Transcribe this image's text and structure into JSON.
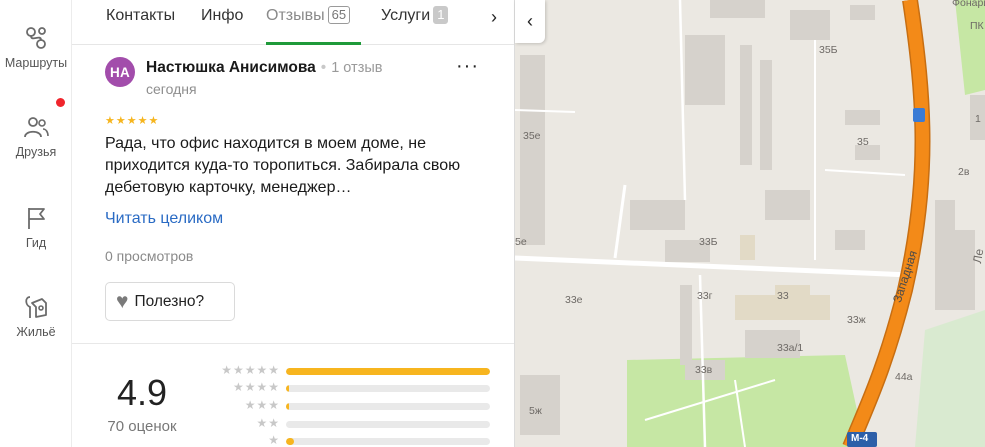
{
  "nav": {
    "items": [
      {
        "label": "Маршруты",
        "icon": "routes-icon"
      },
      {
        "label": "Друзья",
        "icon": "friends-icon"
      },
      {
        "label": "Гид",
        "icon": "flag-icon"
      },
      {
        "label": "Жильё",
        "icon": "housing-icon"
      }
    ]
  },
  "tabs": {
    "items": [
      {
        "label": "Контакты"
      },
      {
        "label": "Инфо"
      },
      {
        "label": "Отзывы",
        "count": "65"
      },
      {
        "label": "Услуги",
        "count": "1"
      }
    ],
    "active": "Отзывы",
    "next_icon": "›"
  },
  "review": {
    "avatar_initials": "НА",
    "author": "Настюшка Анисимова",
    "author_meta": "1 отзыв",
    "date": "сегодня",
    "more_icon": "···",
    "stars": "★★★★★",
    "rating": 5,
    "text": "Рада, что офис находится в моем доме, не приходится куда-то торопиться. Забирала свою дебетовую карточку, менеджер…",
    "read_more": "Читать целиком",
    "views": "0 просмотров",
    "useful_label": "Полезно?"
  },
  "summary": {
    "rating": "4.9",
    "count_label": "70 оценок",
    "distribution": [
      {
        "stars": "★★★★★",
        "fraction": 1.0
      },
      {
        "stars": "★★★★",
        "fraction": 0.015
      },
      {
        "stars": "★★★",
        "fraction": 0.015
      },
      {
        "stars": "★★",
        "fraction": 0.0
      },
      {
        "stars": "★",
        "fraction": 0.04
      }
    ]
  },
  "map": {
    "collapse_icon": "‹",
    "labels": [
      "Фонари",
      "ПК",
      "35Б",
      "35е",
      "35",
      "1",
      "2в",
      "5е",
      "33Б",
      "33г",
      "33",
      "33е",
      "33ж",
      "Западная",
      "33а/1",
      "44а",
      "33в",
      "5ж",
      "М-4",
      "Ле"
    ],
    "colors": {
      "highway": "#f38a18",
      "park": "#c6e7a4",
      "building": "#d6d2cc",
      "road": "#ffffff"
    }
  }
}
